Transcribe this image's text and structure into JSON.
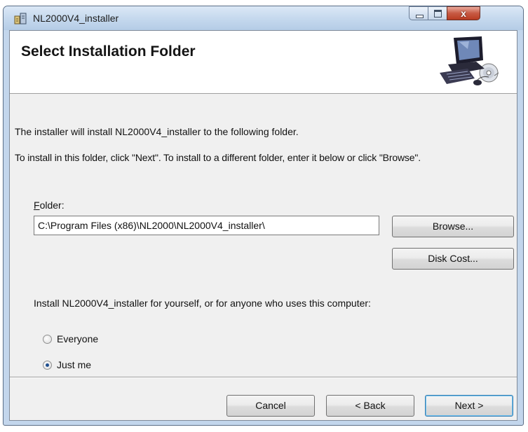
{
  "window": {
    "title": "NL2000V4_installer",
    "close_glyph": "x"
  },
  "banner": {
    "title": "Select Installation Folder",
    "art_icon": "computer-with-cd-icon"
  },
  "content": {
    "line1": "The installer will install NL2000V4_installer to the following folder.",
    "line2": "To install in this folder, click \"Next\". To install to a different folder, enter it below or click \"Browse\".",
    "folder_label_accel": "F",
    "folder_label_rest": "older:",
    "folder_value": "C:\\Program Files (x86)\\NL2000\\NL2000V4_installer\\",
    "browse_label": "Browse...",
    "disk_cost_label": "Disk Cost...",
    "install_for_prompt": "Install NL2000V4_installer for yourself, or for anyone who uses this computer:",
    "radio_everyone": "Everyone",
    "radio_just_me": "Just me",
    "selected_option": "Just me"
  },
  "footer": {
    "cancel_label": "Cancel",
    "back_label": "< Back",
    "next_label": "Next >"
  }
}
